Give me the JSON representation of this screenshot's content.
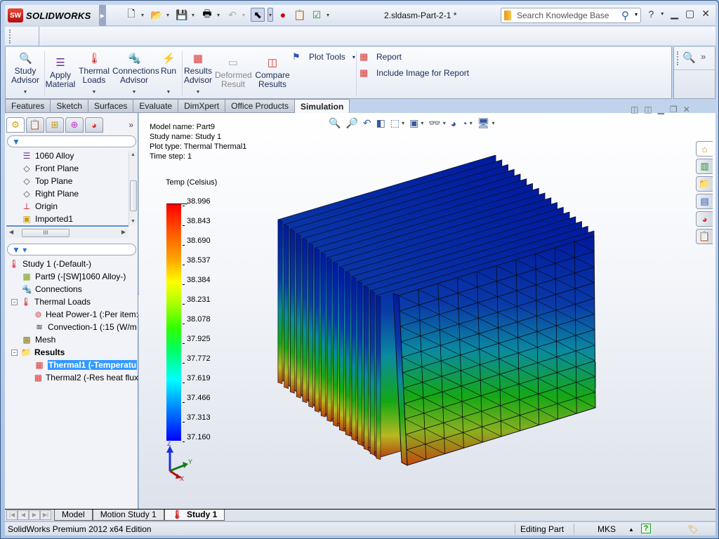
{
  "app": {
    "brand": "SOLIDWORKS",
    "logo_text": "SW",
    "document_title": "2.sldasm-Part-2-1 *",
    "search_placeholder": "Search Knowledge Base"
  },
  "quick_access": [
    {
      "name": "new-document",
      "glyph": "🗋"
    },
    {
      "name": "open",
      "glyph": "📂"
    },
    {
      "name": "save",
      "glyph": "💾"
    },
    {
      "name": "print",
      "glyph": "🖶"
    },
    {
      "name": "undo",
      "glyph": "↶"
    },
    {
      "name": "select",
      "glyph": "⬉"
    },
    {
      "name": "rebuild",
      "glyph": "●"
    },
    {
      "name": "file-properties",
      "glyph": "📋"
    },
    {
      "name": "options",
      "glyph": "☑"
    }
  ],
  "ribbon": {
    "buttons": [
      {
        "id": "study-advisor",
        "label_lines": [
          "Study",
          "Advisor"
        ],
        "glyph": "🔍",
        "disabled": false,
        "dropdown": true
      },
      {
        "id": "apply-material",
        "label_lines": [
          "Apply",
          "Material"
        ],
        "glyph": "☰",
        "disabled": false,
        "dropdown": false
      },
      {
        "id": "thermal-loads",
        "label_lines": [
          "Thermal",
          "Loads"
        ],
        "glyph": "🌡",
        "disabled": false,
        "dropdown": true
      },
      {
        "id": "connections-advisor",
        "label_lines": [
          "Connections",
          "Advisor"
        ],
        "glyph": "🔩",
        "disabled": false,
        "dropdown": true
      },
      {
        "id": "run",
        "label_lines": [
          "Run"
        ],
        "glyph": "⚡",
        "disabled": false,
        "dropdown": true
      },
      {
        "id": "results-advisor",
        "label_lines": [
          "Results",
          "Advisor"
        ],
        "glyph": "▦",
        "disabled": false,
        "dropdown": true
      },
      {
        "id": "deformed-result",
        "label_lines": [
          "Deformed",
          "Result"
        ],
        "glyph": "▭",
        "disabled": true,
        "dropdown": false
      },
      {
        "id": "compare-results",
        "label_lines": [
          "Compare",
          "Results"
        ],
        "glyph": "◫",
        "disabled": false,
        "dropdown": false
      }
    ],
    "plot_tools": "Plot Tools",
    "report": "Report",
    "include_image": "Include Image for Report"
  },
  "command_tabs": [
    "Features",
    "Sketch",
    "Surfaces",
    "Evaluate",
    "DimXpert",
    "Office Products",
    "Simulation"
  ],
  "active_command_tab": "Simulation",
  "feature_manager": {
    "tabs": [
      "feature-manager",
      "property-manager",
      "configuration-manager",
      "dimxpert-manager",
      "display-manager"
    ],
    "tree_items": [
      {
        "label": "1060 Alloy",
        "icon": "material-icon",
        "glyph": "☰"
      },
      {
        "label": "Front Plane",
        "icon": "plane-icon",
        "glyph": "◇"
      },
      {
        "label": "Top Plane",
        "icon": "plane-icon",
        "glyph": "◇"
      },
      {
        "label": "Right Plane",
        "icon": "plane-icon",
        "glyph": "◇"
      },
      {
        "label": "Origin",
        "icon": "origin-icon",
        "glyph": "⊥"
      },
      {
        "label": "Imported1",
        "icon": "imported-feature-icon",
        "glyph": "▣"
      }
    ]
  },
  "simulation_tree": [
    {
      "label": "Study 1 (-Default-)",
      "icon": "study-icon",
      "glyph": "🌡",
      "level": 0,
      "expander": "",
      "bold": false,
      "selected": false
    },
    {
      "label": "Part9 (-[SW]1060 Alloy-)",
      "icon": "part-icon",
      "glyph": "▦",
      "level": 1,
      "expander": "",
      "bold": false,
      "selected": false
    },
    {
      "label": "Connections",
      "icon": "connections-icon",
      "glyph": "🔩",
      "level": 1,
      "expander": "",
      "bold": false,
      "selected": false
    },
    {
      "label": "Thermal Loads",
      "icon": "thermal-loads-icon",
      "glyph": "🌡",
      "level": 1,
      "expander": "−",
      "bold": false,
      "selected": false
    },
    {
      "label": "Heat Power-1 (:Per item:",
      "icon": "heat-power-icon",
      "glyph": "⊚",
      "level": 2,
      "expander": "",
      "bold": false,
      "selected": false
    },
    {
      "label": "Convection-1 (:15 (W/m",
      "icon": "convection-icon",
      "glyph": "≋",
      "level": 2,
      "expander": "",
      "bold": false,
      "selected": false
    },
    {
      "label": "Mesh",
      "icon": "mesh-icon",
      "glyph": "▩",
      "level": 1,
      "expander": "",
      "bold": false,
      "selected": false
    },
    {
      "label": "Results",
      "icon": "results-folder-icon",
      "glyph": "📁",
      "level": 1,
      "expander": "−",
      "bold": true,
      "selected": false
    },
    {
      "label": "Thermal1 (-Temperatu",
      "icon": "thermal-plot-icon",
      "glyph": "▦",
      "level": 2,
      "expander": "",
      "bold": false,
      "selected": true
    },
    {
      "label": "Thermal2 (-Res heat flux",
      "icon": "thermal-plot-icon",
      "glyph": "▦",
      "level": 2,
      "expander": "",
      "bold": false,
      "selected": false
    }
  ],
  "plot_info": {
    "model_name": "Model name: Part9",
    "study_name": "Study name: Study 1",
    "plot_type": "Plot type: Thermal Thermal1",
    "time_step": "Time step: 1"
  },
  "legend": {
    "title": "Temp (Celsius)",
    "max": 38.996,
    "min": 37.16,
    "ticks": [
      "38.996",
      "38.843",
      "38.690",
      "38.537",
      "38.384",
      "38.231",
      "38.078",
      "37.925",
      "37.772",
      "37.619",
      "37.466",
      "37.313",
      "37.160"
    ]
  },
  "triad": {
    "x": "X",
    "y": "Y",
    "z": "Z"
  },
  "view_toolbar": [
    {
      "name": "zoom-to-fit",
      "glyph": "🔍",
      "dropdown": false
    },
    {
      "name": "zoom-to-area",
      "glyph": "🔎",
      "dropdown": false
    },
    {
      "name": "previous-view",
      "glyph": "↶",
      "dropdown": false
    },
    {
      "name": "section-view",
      "glyph": "◧",
      "dropdown": false
    },
    {
      "name": "view-orientation",
      "glyph": "⬚",
      "dropdown": true
    },
    {
      "name": "display-style",
      "glyph": "▣",
      "dropdown": true
    },
    {
      "name": "hide-show-items",
      "glyph": "👓",
      "dropdown": true
    },
    {
      "name": "edit-appearance",
      "glyph": "◕",
      "dropdown": false
    },
    {
      "name": "apply-scene",
      "glyph": "◔",
      "dropdown": true
    },
    {
      "name": "view-settings",
      "glyph": "🖥",
      "dropdown": true
    }
  ],
  "task_pane": [
    "home-icon",
    "design-library-icon",
    "file-explorer-icon",
    "view-palette-icon",
    "appearances-icon",
    "custom-properties-icon"
  ],
  "bottom_tabs": [
    "Model",
    "Motion Study 1",
    "Study 1"
  ],
  "active_bottom_tab": "Study 1",
  "status": {
    "edition": "SolidWorks Premium 2012 x64 Edition",
    "mode": "Editing Part",
    "units": "MKS"
  },
  "colors": {
    "selection": "#3399ff",
    "accent": "#1a2b55"
  }
}
